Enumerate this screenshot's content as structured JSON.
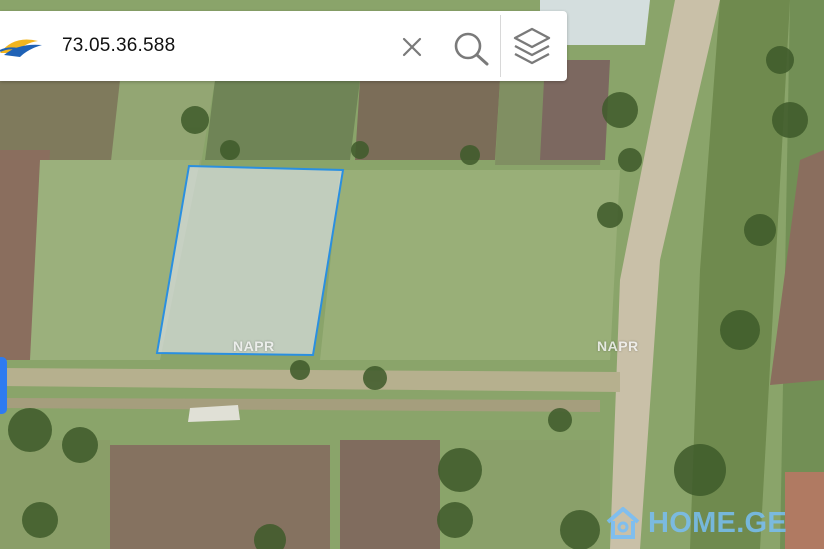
{
  "search": {
    "query": "73.05.36.588"
  },
  "icons": {
    "logo": "napr-logo",
    "clear": "close-icon",
    "search": "search-icon",
    "layers": "layers-icon",
    "watermark": "home-icon"
  },
  "map": {
    "labels": [
      "NAPR",
      "NAPR"
    ],
    "watermark": "HOME.GE",
    "parcel_color": "#2a8fe0"
  },
  "colors": {
    "accent": "#2e7bf0",
    "icon_gray": "#7a7a7a"
  }
}
